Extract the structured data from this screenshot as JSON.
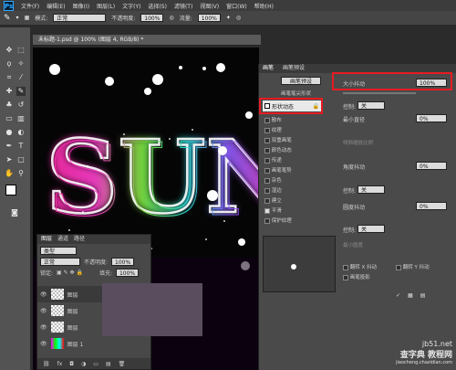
{
  "menu": {
    "logo": "Ps",
    "items": [
      "文件(F)",
      "编辑(E)",
      "图像(I)",
      "图层(L)",
      "文字(Y)",
      "选择(S)",
      "滤镜(T)",
      "视图(V)",
      "窗口(W)",
      "帮助(H)"
    ]
  },
  "options": {
    "mode_label": "模式:",
    "mode_value": "正常",
    "opacity_label": "不透明度:",
    "opacity_value": "100%",
    "flow_label": "流量:",
    "flow_value": "100%"
  },
  "document": {
    "tab": "未标题-1.psd @ 100% (图层 4, RGB/8) *"
  },
  "layers": {
    "tabs": [
      "图层",
      "通道",
      "路径"
    ],
    "kind_label": "类型",
    "blend": "正常",
    "opacity_label": "不透明度:",
    "opacity": "100%",
    "lock_label": "锁定:",
    "fill_label": "填充:",
    "fill": "100%",
    "items": [
      {
        "name": "图层"
      },
      {
        "name": "图层"
      },
      {
        "name": "图层"
      },
      {
        "name": "图层 1"
      }
    ]
  },
  "brush_panel": {
    "tabs": [
      "画笔",
      "画笔预设"
    ],
    "preset_button": "画笔预设",
    "tip_header": "画笔笔尖形状",
    "list": [
      "形状动态",
      "散布",
      "纹理",
      "双重画笔",
      "颜色动态",
      "传递",
      "画笔笔势",
      "杂色",
      "湿边",
      "建立",
      "平滑",
      "保护纹理"
    ],
    "size_jitter_label": "大小抖动",
    "size_jitter_value": "100%",
    "control_label": "控制:",
    "control_value": "关",
    "min_diameter_label": "最小直径",
    "min_diameter_value": "0%",
    "tilt_scale_label": "倾斜缩放比例",
    "angle_jitter_label": "角度抖动",
    "angle_jitter_value": "0%",
    "roundness_jitter_label": "圆度抖动",
    "roundness_jitter_value": "0%",
    "min_roundness_label": "最小圆度",
    "flip_x": "翻转 X 抖动",
    "flip_y": "翻转 Y 抖动",
    "brush_projection": "画笔投影"
  },
  "watermark": {
    "line1": "jb51.net",
    "line2": "查字典 教程网",
    "line3": "jiaocheng.chazidian.com"
  },
  "colors": {
    "red": "#e51c23",
    "bg": "#2b2b2b"
  }
}
